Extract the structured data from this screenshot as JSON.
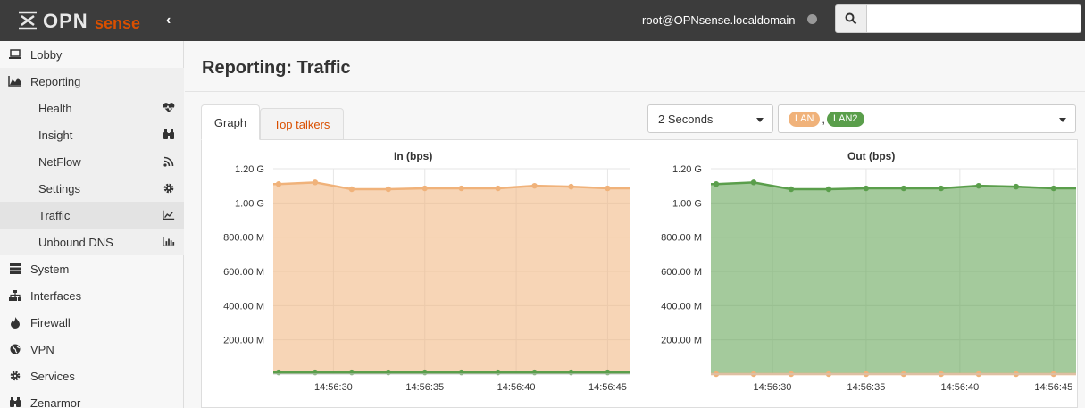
{
  "header": {
    "logo_text": "OPNsense",
    "user": "root@OPNsense.localdomain",
    "search_placeholder": ""
  },
  "sidebar": {
    "items": [
      {
        "label": "Lobby",
        "icon": "laptop-icon"
      },
      {
        "label": "Reporting",
        "icon": "area-chart-icon"
      },
      {
        "label": "Health",
        "icon": "heartbeat-icon"
      },
      {
        "label": "Insight",
        "icon": "binoculars-icon"
      },
      {
        "label": "NetFlow",
        "icon": "rss-icon"
      },
      {
        "label": "Settings",
        "icon": "cog-icon"
      },
      {
        "label": "Traffic",
        "icon": "line-chart-icon"
      },
      {
        "label": "Unbound DNS",
        "icon": "bar-chart-icon"
      },
      {
        "label": "System",
        "icon": "server-icon"
      },
      {
        "label": "Interfaces",
        "icon": "sitemap-icon"
      },
      {
        "label": "Firewall",
        "icon": "fire-icon"
      },
      {
        "label": "VPN",
        "icon": "globe-icon"
      },
      {
        "label": "Services",
        "icon": "cog-icon"
      },
      {
        "label": "Zenarmor",
        "icon": "binoculars-icon"
      }
    ]
  },
  "main": {
    "title": "Reporting: Traffic",
    "tabs": [
      {
        "label": "Graph"
      },
      {
        "label": "Top talkers"
      }
    ],
    "interval": "2 Seconds",
    "interfaces": [
      "LAN",
      "LAN2"
    ],
    "separator": ","
  },
  "colors": {
    "accent": "#d94f00",
    "lan": "#f0b27a",
    "lan2": "#5a9e4b"
  },
  "chart_data": [
    {
      "type": "area",
      "title": "In (bps)",
      "x": [
        "14:56:27",
        "14:56:29",
        "14:56:31",
        "14:56:33",
        "14:56:35",
        "14:56:37",
        "14:56:39",
        "14:56:41",
        "14:56:43",
        "14:56:45"
      ],
      "xticks": [
        "14:56:30",
        "14:56:35",
        "14:56:40",
        "14:56:45"
      ],
      "yticks": [
        "200.00 M",
        "400.00 M",
        "600.00 M",
        "800.00 M",
        "1.00 G",
        "1.20 G"
      ],
      "ylim": [
        0,
        1.2
      ],
      "y_unit": "G",
      "series": [
        {
          "name": "LAN",
          "values": [
            1.11,
            1.12,
            1.08,
            1.08,
            1.085,
            1.085,
            1.085,
            1.1,
            1.095,
            1.085
          ]
        },
        {
          "name": "LAN2",
          "values": [
            0.01,
            0.01,
            0.01,
            0.01,
            0.01,
            0.01,
            0.01,
            0.01,
            0.01,
            0.01
          ]
        }
      ]
    },
    {
      "type": "area",
      "title": "Out (bps)",
      "x": [
        "14:56:27",
        "14:56:29",
        "14:56:31",
        "14:56:33",
        "14:56:35",
        "14:56:37",
        "14:56:39",
        "14:56:41",
        "14:56:43",
        "14:56:45"
      ],
      "xticks": [
        "14:56:30",
        "14:56:35",
        "14:56:40",
        "14:56:45"
      ],
      "yticks": [
        "200.00 M",
        "400.00 M",
        "600.00 M",
        "800.00 M",
        "1.00 G",
        "1.20 G"
      ],
      "ylim": [
        0,
        1.2
      ],
      "y_unit": "G",
      "series": [
        {
          "name": "LAN2",
          "values": [
            1.11,
            1.12,
            1.08,
            1.08,
            1.085,
            1.085,
            1.085,
            1.1,
            1.095,
            1.085
          ]
        },
        {
          "name": "LAN",
          "values": [
            0.0,
            0.0,
            0.0,
            0.0,
            0.0,
            0.0,
            0.0,
            0.0,
            0.0,
            0.0
          ]
        }
      ]
    }
  ]
}
